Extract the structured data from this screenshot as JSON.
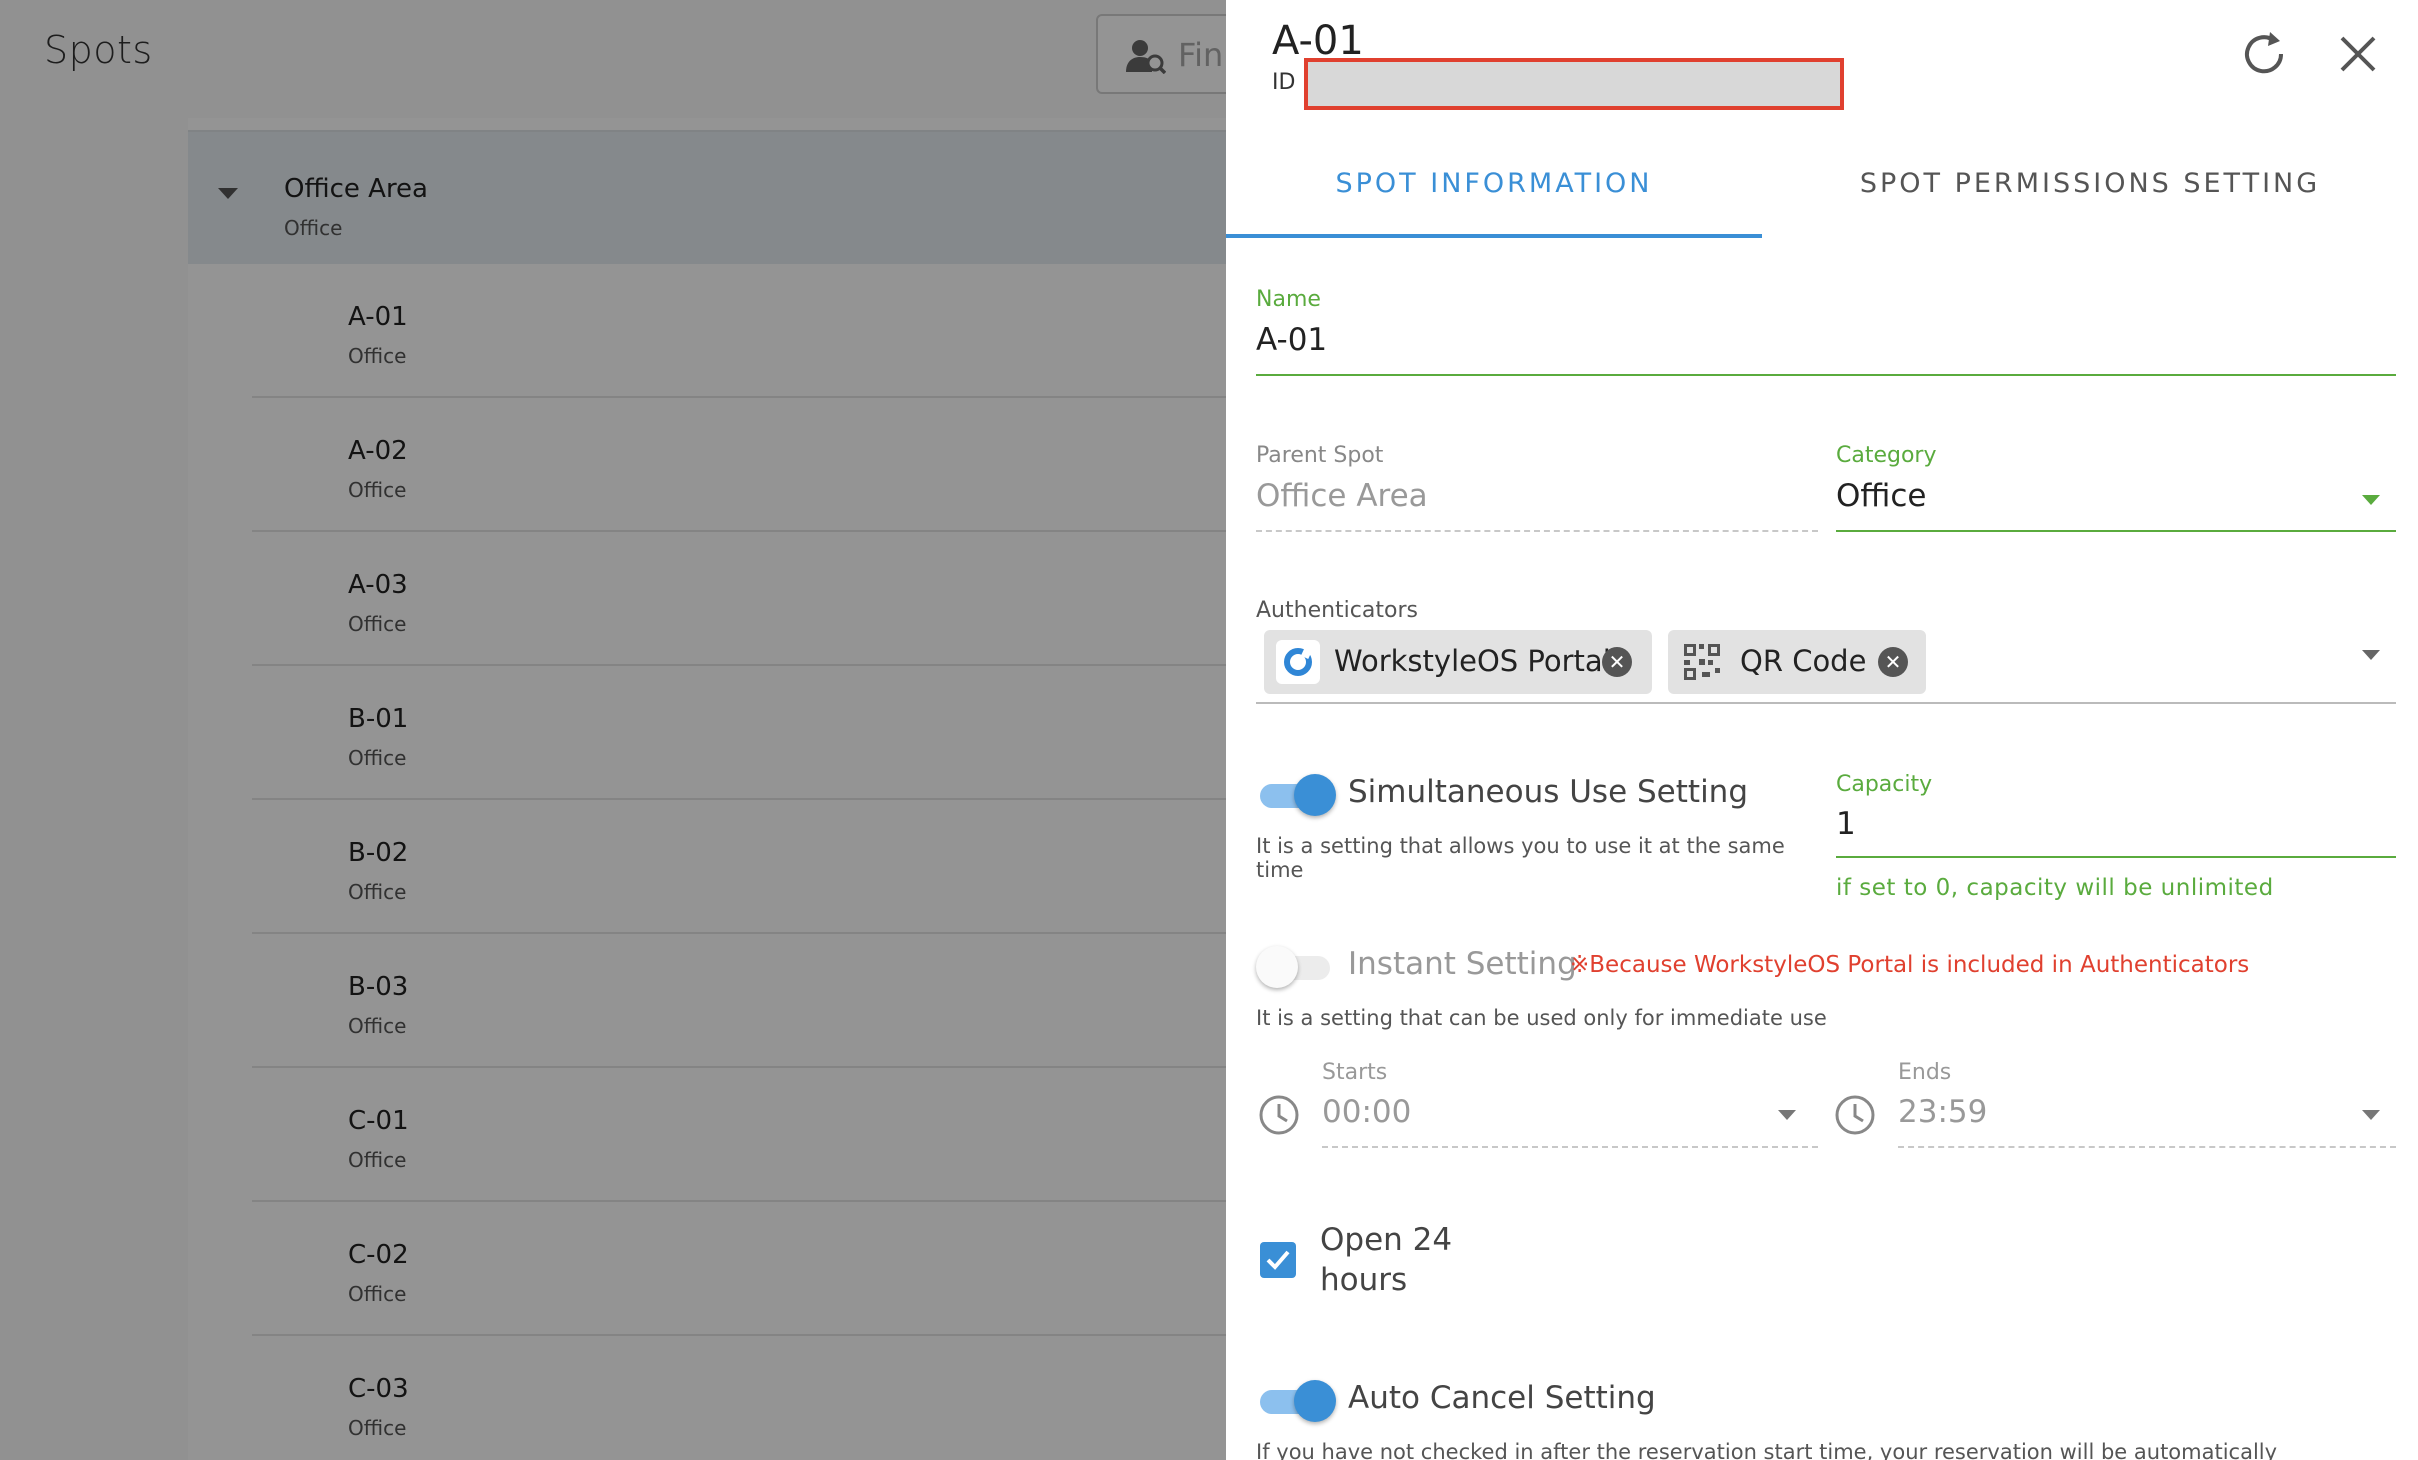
{
  "page": {
    "title": "Spots",
    "search_placeholder": "Fin"
  },
  "tree": {
    "group": {
      "name": "Office Area",
      "category": "Office"
    },
    "spots": [
      {
        "name": "A-01",
        "category": "Office"
      },
      {
        "name": "A-02",
        "category": "Office"
      },
      {
        "name": "A-03",
        "category": "Office"
      },
      {
        "name": "B-01",
        "category": "Office"
      },
      {
        "name": "B-02",
        "category": "Office"
      },
      {
        "name": "B-03",
        "category": "Office"
      },
      {
        "name": "C-01",
        "category": "Office"
      },
      {
        "name": "C-02",
        "category": "Office"
      },
      {
        "name": "C-03",
        "category": "Office"
      }
    ]
  },
  "panel": {
    "title": "A-01",
    "id_label": "ID",
    "tabs": [
      "SPOT INFORMATION",
      "SPOT PERMISSIONS SETTING"
    ],
    "name_label": "Name",
    "name_value": "A-01",
    "parent_label": "Parent Spot",
    "parent_value": "Office Area",
    "category_label": "Category",
    "category_value": "Office",
    "authenticators_label": "Authenticators",
    "authenticators": [
      "WorkstyleOS Portal",
      "QR Code"
    ],
    "simultaneous": {
      "label": "Simultaneous Use Setting",
      "enabled": true,
      "hint": "It is a setting that allows you to use it at the same time"
    },
    "capacity": {
      "label": "Capacity",
      "value": "1",
      "note": "if set to 0, capacity will be unlimited"
    },
    "instant": {
      "label": "Instant Setting",
      "enabled": false,
      "warning": "※Because WorkstyleOS Portal is included in Authenticators",
      "hint": "It is a setting that can be used only for immediate use"
    },
    "starts": {
      "label": "Starts",
      "value": "00:00"
    },
    "ends": {
      "label": "Ends",
      "value": "23:59"
    },
    "open24": {
      "line1": "Open 24",
      "line2": "hours",
      "checked": true
    },
    "auto_cancel": {
      "label": "Auto Cancel Setting",
      "enabled": true,
      "hint": "If you have not checked in after the reservation start time, your reservation will be automatically"
    }
  },
  "colors": {
    "accent": "#3a8fd6",
    "green": "#5aab3e",
    "warning": "#e0402f"
  }
}
